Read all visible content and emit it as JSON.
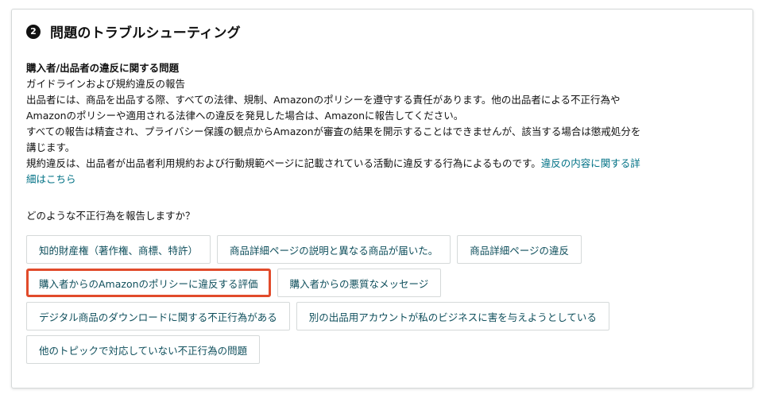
{
  "section": {
    "step_number": "2",
    "title": "問題のトラブルシューティング"
  },
  "issue": {
    "title": "購入者/出品者の違反に関する問題",
    "subtitle": "ガイドラインおよび規約違反の報告",
    "paragraph1_line1": "出品者には、商品を出品する際、すべての法律、規制、Amazonのポリシーを遵守する責任があります。他の出品者による不正行為や",
    "paragraph1_line2": "Amazonのポリシーや適用される法律への違反を発見した場合は、Amazonに報告してください。",
    "paragraph2_line1": "すべての報告は精査され、プライバシー保護の観点からAmazonが審査の結果を開示することはできませんが、該当する場合は懲戒処分を",
    "paragraph2_line2": "講じます。",
    "paragraph3_text": "規約違反は、出品者が出品者利用規約および行動規範ページに記載されている活動に違反する行為によるものです。",
    "paragraph3_link_part1": "違反の内容に関する詳",
    "paragraph3_link_part2": "細はこちら"
  },
  "question": "どのような不正行為を報告しますか？",
  "options": [
    {
      "label": "知的財産権（著作権、商標、特許）",
      "selected": false
    },
    {
      "label": "商品詳細ページの説明と異なる商品が届いた。",
      "selected": false
    },
    {
      "label": "商品詳細ページの違反",
      "selected": false
    },
    {
      "label": "購入者からのAmazonのポリシーに違反する評価",
      "selected": true
    },
    {
      "label": "購入者からの悪質なメッセージ",
      "selected": false
    },
    {
      "label": "デジタル商品のダウンロードに関する不正行為がある",
      "selected": false
    },
    {
      "label": "別の出品用アカウントが私のビジネスに害を与えようとしている",
      "selected": false
    },
    {
      "label": "他のトピックで対応していない不正行為の問題",
      "selected": false
    }
  ],
  "colors": {
    "link": "#007185",
    "option_text": "#0f4f5c",
    "selected_border": "#e14b2b"
  }
}
